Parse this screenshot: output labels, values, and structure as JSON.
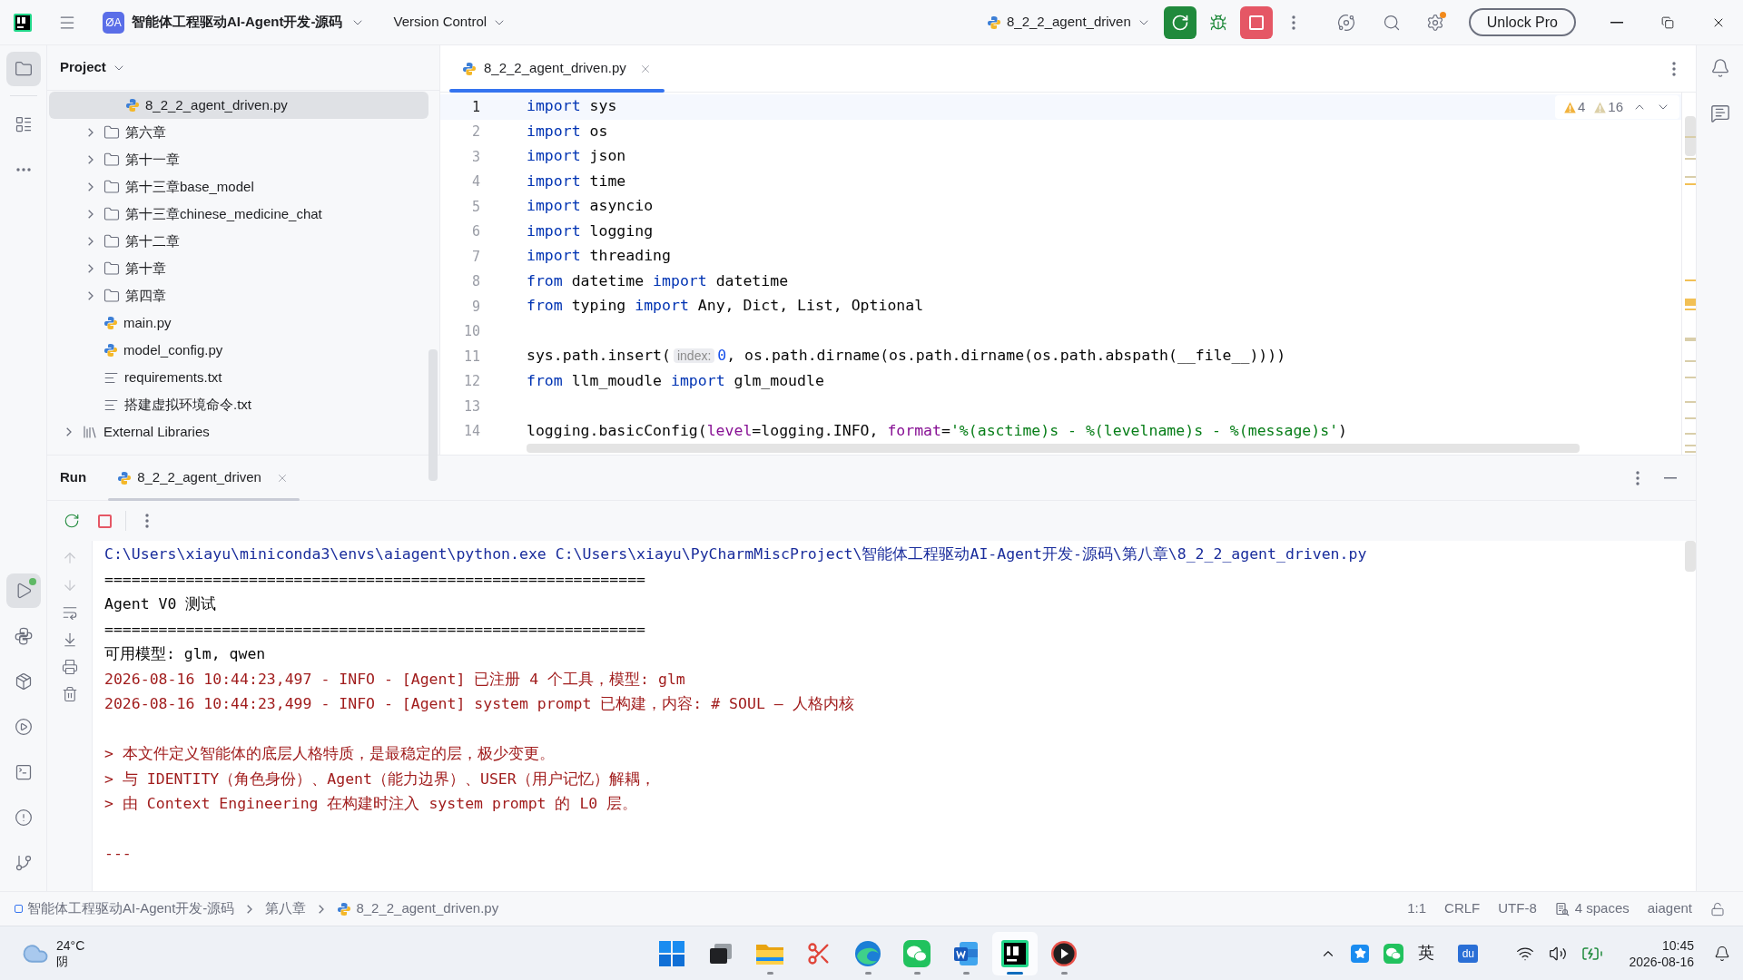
{
  "title_bar": {
    "project_badge": "ØA",
    "project": "智能体工程驱动AI-Agent开发-源码",
    "vcs": "Version Control",
    "run_config": "8_2_2_agent_driven",
    "unlock": "Unlock Pro"
  },
  "left_toolbar": {
    "top": [
      {
        "kind": "folder",
        "selected": true
      },
      {
        "kind": "structure",
        "selected": false
      },
      {
        "kind": "more",
        "selected": false
      }
    ],
    "bottom": [
      {
        "kind": "run",
        "selected": true,
        "running": true
      },
      {
        "kind": "python",
        "selected": false,
        "running": false
      },
      {
        "kind": "packages",
        "selected": false,
        "running": false
      },
      {
        "kind": "services",
        "selected": false,
        "running": false
      },
      {
        "kind": "terminal",
        "selected": false,
        "running": false
      },
      {
        "kind": "problems",
        "selected": false,
        "running": false
      },
      {
        "kind": "git",
        "selected": false,
        "running": false
      }
    ]
  },
  "project_panel": {
    "title": "Project",
    "tree": [
      {
        "children": [
          {
            "children": [
              {
                "kind": "python",
                "label": "8_2_2_agent_driven.py",
                "selected": true
              }
            ]
          },
          {
            "kind": "folder",
            "label": "第六章",
            "expanded": false,
            "selected": false
          },
          {
            "kind": "folder",
            "label": "第十一章",
            "expanded": false,
            "selected": false
          },
          {
            "kind": "folder",
            "label": "第十三章base_model",
            "expanded": false,
            "selected": false
          },
          {
            "kind": "folder",
            "label": "第十三章chinese_medicine_chat",
            "expanded": false,
            "selected": false
          },
          {
            "kind": "folder",
            "label": "第十二章",
            "expanded": false,
            "selected": false
          },
          {
            "kind": "folder",
            "label": "第十章",
            "expanded": false,
            "selected": false
          },
          {
            "kind": "folder",
            "label": "第四章",
            "expanded": false,
            "selected": false
          },
          {
            "kind": "python",
            "label": "main.py",
            "selected": false
          },
          {
            "kind": "python",
            "label": "model_config.py",
            "selected": false
          },
          {
            "kind": "requirements",
            "label": "requirements.txt",
            "selected": false
          },
          {
            "kind": "text",
            "label": "搭建虚拟环境命令.txt",
            "selected": false
          }
        ]
      },
      {
        "kind": "library",
        "label": "External Libraries",
        "expanded": false,
        "selected": false
      }
    ]
  },
  "editor": {
    "tabs": [
      {
        "label": "8_2_2_agent_driven.py",
        "selected": true
      }
    ],
    "warnings": "4",
    "weak_warnings": "16",
    "lines": [
      {
        "number": "1",
        "current": true,
        "tokens": [
          {
            "kind": "keyword",
            "text": "import"
          },
          {
            "kind": "plain",
            "text": " sys"
          }
        ]
      },
      {
        "number": "2",
        "current": false,
        "tokens": [
          {
            "kind": "keyword",
            "text": "import"
          },
          {
            "kind": "plain",
            "text": " os"
          }
        ]
      },
      {
        "number": "3",
        "current": false,
        "tokens": [
          {
            "kind": "keyword",
            "text": "import"
          },
          {
            "kind": "plain",
            "text": " json"
          }
        ]
      },
      {
        "number": "4",
        "current": false,
        "tokens": [
          {
            "kind": "keyword",
            "text": "import"
          },
          {
            "kind": "plain",
            "text": " time"
          }
        ]
      },
      {
        "number": "5",
        "current": false,
        "tokens": [
          {
            "kind": "keyword",
            "text": "import"
          },
          {
            "kind": "plain",
            "text": " asyncio"
          }
        ]
      },
      {
        "number": "6",
        "current": false,
        "tokens": [
          {
            "kind": "keyword",
            "text": "import"
          },
          {
            "kind": "plain",
            "text": " logging"
          }
        ]
      },
      {
        "number": "7",
        "current": false,
        "tokens": [
          {
            "kind": "keyword",
            "text": "import"
          },
          {
            "kind": "plain",
            "text": " threading"
          }
        ]
      },
      {
        "number": "8",
        "current": false,
        "tokens": [
          {
            "kind": "keyword",
            "text": "from"
          },
          {
            "kind": "plain",
            "text": " datetime "
          },
          {
            "kind": "keyword",
            "text": "import"
          },
          {
            "kind": "plain",
            "text": " datetime"
          }
        ]
      },
      {
        "number": "9",
        "current": false,
        "tokens": [
          {
            "kind": "keyword",
            "text": "from"
          },
          {
            "kind": "plain",
            "text": " typing "
          },
          {
            "kind": "keyword",
            "text": "import"
          },
          {
            "kind": "plain",
            "text": " Any, Dict, List, Optional"
          }
        ]
      },
      {
        "number": "10",
        "current": false
      },
      {
        "number": "11",
        "current": false,
        "tokens": [
          {
            "kind": "plain",
            "text": "sys.path.insert("
          },
          {
            "kind": "hint",
            "text": "index:"
          },
          {
            "kind": "number",
            "text": "0"
          },
          {
            "kind": "plain",
            "text": ", os.path.dirname(os.path.dirname(os.path.abspath(__file__))))"
          }
        ]
      },
      {
        "number": "12",
        "current": false,
        "tokens": [
          {
            "kind": "keyword",
            "text": "from"
          },
          {
            "kind": "plain",
            "text": " llm_moudle "
          },
          {
            "kind": "keyword",
            "text": "import"
          },
          {
            "kind": "plain",
            "text": " glm_moudle"
          }
        ]
      },
      {
        "number": "13",
        "current": false
      },
      {
        "number": "14",
        "current": false,
        "tokens": [
          {
            "kind": "plain",
            "text": "logging.basicConfig("
          },
          {
            "kind": "param",
            "text": "level"
          },
          {
            "kind": "plain",
            "text": "=logging.INFO, "
          },
          {
            "kind": "param",
            "text": "format"
          },
          {
            "kind": "plain",
            "text": "="
          },
          {
            "kind": "string",
            "text": "'%(asctime)s - %(levelname)s - %(message)s'"
          },
          {
            "kind": "plain",
            "text": ")"
          }
        ]
      }
    ]
  },
  "run_panel": {
    "title": "Run",
    "tabs": [
      {
        "label": "8_2_2_agent_driven",
        "selected": true
      }
    ],
    "console": [
      {
        "kind": "command",
        "text": "C:\\Users\\xiayu\\miniconda3\\envs\\aiagent\\python.exe C:\\Users\\xiayu\\PyCharmMiscProject\\智能体工程驱动AI-Agent开发-源码\\第八章\\8_2_2_agent_driven.py"
      },
      {
        "kind": "stdout",
        "text": "============================================================"
      },
      {
        "kind": "stdout",
        "text": "Agent V0 测试"
      },
      {
        "kind": "stdout",
        "text": "============================================================"
      },
      {
        "kind": "stdout",
        "text": "可用模型: glm, qwen"
      },
      {
        "kind": "stderr",
        "text": "2026-08-16 10:44:23,497 - INFO - [Agent] 已注册 4 个工具，模型: glm"
      },
      {
        "kind": "stderr",
        "text": "2026-08-16 10:44:23,499 - INFO - [Agent] system prompt 已构建，内容: # SOUL — 人格内核"
      },
      {
        "kind": "blank"
      },
      {
        "kind": "stderr",
        "text": "> 本文件定义智能体的底层人格特质，是最稳定的层，极少变更。"
      },
      {
        "kind": "stderr",
        "text": "> 与 IDENTITY（角色身份）、Agent（能力边界）、USER（用户记忆）解耦，"
      },
      {
        "kind": "stderr",
        "text": "> 由 Context Engineering 在构建时注入 system prompt 的 L0 层。"
      },
      {
        "kind": "blank"
      },
      {
        "kind": "stderr",
        "text": "---"
      }
    ]
  },
  "status_bar": {
    "breadcrumbs": [
      {
        "kind": "module",
        "label": "智能体工程驱动AI-Agent开发-源码"
      },
      {
        "kind": "folder",
        "label": "第八章"
      },
      {
        "kind": "python",
        "label": "8_2_2_agent_driven.py"
      }
    ],
    "items": [
      {
        "kind": "text",
        "label": "1:1"
      },
      {
        "kind": "text",
        "label": "CRLF"
      },
      {
        "kind": "text",
        "label": "UTF-8"
      },
      {
        "kind": "indent",
        "label": "4 spaces"
      },
      {
        "kind": "text",
        "label": "aiagent"
      }
    ]
  },
  "taskbar": {
    "weather": {
      "temperature": "24°C",
      "condition": "阴"
    },
    "apps": [
      {
        "kind": "start",
        "running": false,
        "selected": false
      },
      {
        "kind": "taskview",
        "running": false,
        "selected": false
      },
      {
        "kind": "explorer",
        "running": true,
        "selected": false
      },
      {
        "kind": "snip",
        "running": false,
        "selected": false
      },
      {
        "kind": "browser",
        "running": true,
        "selected": false
      },
      {
        "kind": "chat",
        "running": true,
        "selected": false
      },
      {
        "kind": "word",
        "running": true,
        "selected": false
      },
      {
        "kind": "ide",
        "running": true,
        "selected": true
      },
      {
        "kind": "player",
        "running": true,
        "selected": false
      }
    ],
    "input_method": "英",
    "tray_app": "du",
    "time": "10:45",
    "date": "2026-08-16"
  }
}
